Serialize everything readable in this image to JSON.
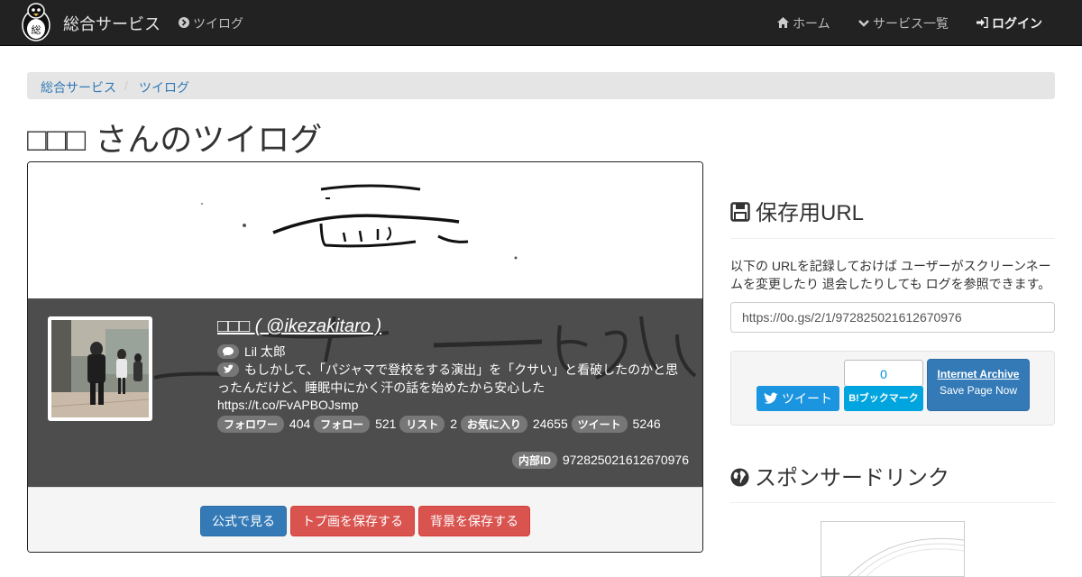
{
  "navbar": {
    "brand": "総合サービス",
    "twilog_link": "ツイログ",
    "home": "ホーム",
    "services": "サービス一覧",
    "login": "ログイン"
  },
  "breadcrumb": {
    "items": [
      "総合サービス",
      "ツイログ"
    ],
    "separator": "/"
  },
  "page_title": "□□□ さんのツイログ",
  "profile": {
    "display_name": "□□□ ( @ikezakitaro )",
    "location": "Lil 太郎",
    "bio": "もしかして、「パジャマで登校をする演出」を「クサい」と看破したのかと思ったんだけど、睡眠中にかく汗の話を始めたから安心した",
    "link": "https://t.co/FvAPBOJsmp",
    "stats": [
      {
        "label": "フォロワー",
        "value": "404"
      },
      {
        "label": "フォロー",
        "value": "521"
      },
      {
        "label": "リスト",
        "value": "2"
      },
      {
        "label": "お気に入り",
        "value": "24655"
      },
      {
        "label": "ツイート",
        "value": "5246"
      }
    ],
    "internal_id_label": "内部ID",
    "internal_id": "972825021612670976"
  },
  "actions": {
    "official": "公式で見る",
    "save_top_image": "トプ画を保存する",
    "save_background": "背景を保存する"
  },
  "sidebar": {
    "save_url_heading": "保存用URL",
    "save_url_text": "以下の URLを記録しておけば ユーザーがスクリーンネームを変更したり 退会したりしても ログを参照できます。",
    "save_url_value": "https://0o.gs/2/1/972825021612670976",
    "tweet_button": "ツイート",
    "hatena_count": "0",
    "hatena_button": "B!ブックマーク",
    "ia_title": "Internet Archive",
    "ia_sub": "Save Page Now",
    "sponsor_heading": "スポンサードリンク"
  },
  "colors": {
    "navbar_bg": "#222222",
    "primary": "#337ab7",
    "danger": "#d9534f",
    "twitter": "#1b95e0",
    "hatena": "#00a4de"
  }
}
